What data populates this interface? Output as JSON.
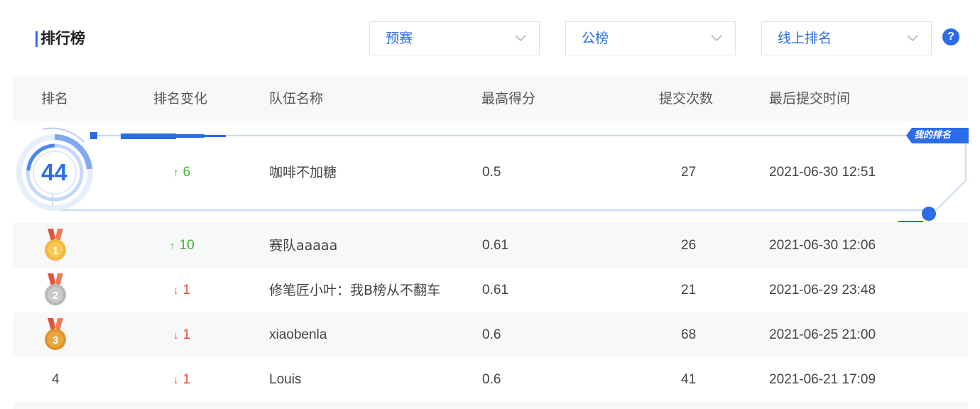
{
  "header": {
    "title": "排行榜",
    "selects": [
      {
        "label": "预赛"
      },
      {
        "label": "公榜"
      },
      {
        "label": "线上排名"
      }
    ],
    "help_glyph": "?"
  },
  "table": {
    "columns": [
      "排名",
      "排名变化",
      "队伍名称",
      "最高得分",
      "提交次数",
      "最后提交时间"
    ],
    "my_row": {
      "badge": "我的排名",
      "rank": "44",
      "change": "6",
      "change_dir": "up",
      "team": "咖啡不加糖",
      "score": "0.5",
      "submissions": "27",
      "last_submit": "2021-06-30 12:51"
    },
    "rows": [
      {
        "rank": "1",
        "medal": "gold-medal-icon",
        "change": "10",
        "change_dir": "up",
        "team": "赛队aaaaa",
        "score": "0.61",
        "submissions": "26",
        "last_submit": "2021-06-30 12:06"
      },
      {
        "rank": "2",
        "medal": "silver-medal-icon",
        "change": "1",
        "change_dir": "down",
        "team": "修笔匠小叶：我B榜从不翻车",
        "score": "0.61",
        "submissions": "21",
        "last_submit": "2021-06-29 23:48"
      },
      {
        "rank": "3",
        "medal": "bronze-medal-icon",
        "change": "1",
        "change_dir": "down",
        "team": "xiaobenla",
        "score": "0.6",
        "submissions": "68",
        "last_submit": "2021-06-25 21:00"
      },
      {
        "rank": "4",
        "medal": "",
        "change": "1",
        "change_dir": "down",
        "team": "Louis",
        "score": "0.6",
        "submissions": "41",
        "last_submit": "2021-06-21 17:09"
      }
    ]
  },
  "colors": {
    "accent": "#2b6de8",
    "up": "#43b43a",
    "down": "#e5473b",
    "header_bg": "#f7f8fa",
    "gold": "#f5b93a",
    "silver": "#b8b8b8",
    "bronze": "#e0952b"
  }
}
